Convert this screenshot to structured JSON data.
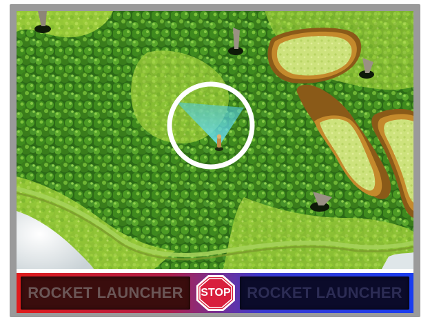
{
  "hud": {
    "left_weapon_label": "ROCKET LAUNCHER",
    "right_weapon_label": "ROCKET LAUNCHER",
    "stop_label": "STOP"
  },
  "colors": {
    "left_player": "#e01c1c",
    "right_player": "#1a3df0",
    "stop_sign": "#d81e3c",
    "selection_ring": "#ffffff",
    "vision_cone": "#5fd6e6",
    "forest_dark": "#1f5a12",
    "forest_light": "#7fbf2a",
    "clearing": "#c8e07a",
    "cliff_edge": "#a0701e",
    "water": "#e8eef0"
  },
  "icons": {
    "selected_unit": "soldier-icon",
    "stop": "stop-sign-icon",
    "map_objects": "tree-stump-icon"
  }
}
